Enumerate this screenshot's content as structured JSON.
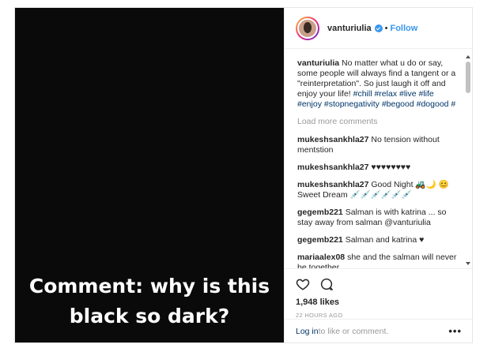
{
  "overlay": {
    "line1": "Comment: why is this",
    "line2": "black so dark?"
  },
  "post": {
    "username": "vanturiulia",
    "separator": "•",
    "follow_label": "Follow",
    "verified_icon": "verified-badge-icon",
    "accent_color": "#3897f0"
  },
  "caption": {
    "username": "vanturiulia",
    "text": "No matter what u do or say, some people will always find a tangent or a \"reinterpretation\". So just laugh it off and enjoy your life!",
    "hashtags": "#chill #relax #live #life #enjoy #stopnegativity #begood #dogood #"
  },
  "load_more": "Load more comments",
  "comments": [
    {
      "user": "mukeshsankhla27",
      "text": "No tension without mentstion"
    },
    {
      "user": "mukeshsankhla27",
      "text": "♥♥♥♥♥♥♥♥"
    },
    {
      "user": "mukeshsankhla27",
      "text": "Good Night 🚜🌙 😊 Sweet Dream 💉💉💉💉💉💉"
    },
    {
      "user": "gegemb221",
      "text": "Salman is with katrina ... so stay away from salman @vanturiulia"
    },
    {
      "user": "gegemb221",
      "text": "Salman and katrina ♥"
    },
    {
      "user": "mariaalex08",
      "text": "she and the salman will never be together"
    }
  ],
  "actions": {
    "like_icon": "heart-icon",
    "comment_icon": "comment-icon",
    "likes": "1,948 likes",
    "time": "22 HOURS AGO"
  },
  "footer": {
    "login_label": "Log in",
    "rest": " to like or comment.",
    "more_icon": "more-options-icon",
    "more_label": "•••"
  }
}
